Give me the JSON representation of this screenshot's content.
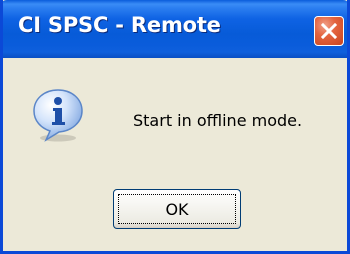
{
  "dialog": {
    "title": "CI SPSC - Remote",
    "message": "Start in offline mode.",
    "icon": "information-icon",
    "buttons": {
      "ok_label": "OK"
    },
    "close_icon": "close-icon"
  },
  "colors": {
    "titlebar": "#0a5cdb",
    "frame": "#0b49d7",
    "dialog_background": "#ece9d8",
    "close_button": "#e4643f",
    "button_border": "#003c74"
  }
}
